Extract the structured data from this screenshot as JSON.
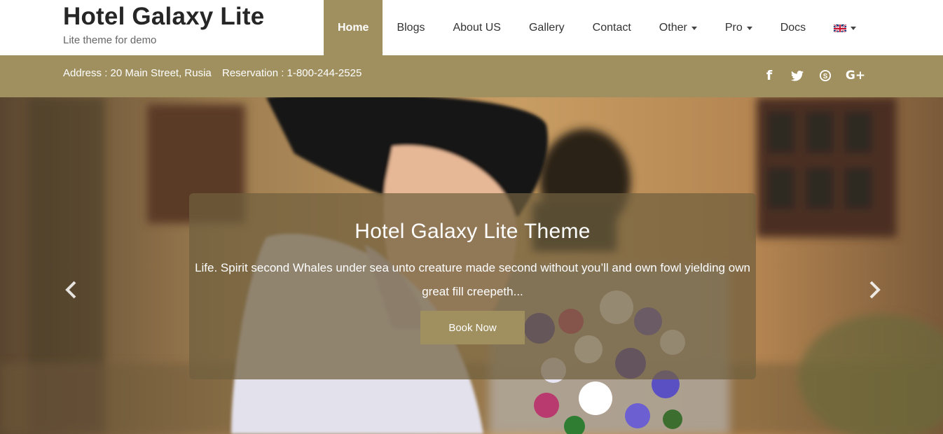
{
  "brand": {
    "title": "Hotel Galaxy Lite",
    "tagline": "Lite theme for demo"
  },
  "nav": {
    "home": "Home",
    "blogs": "Blogs",
    "about": "About US",
    "gallery": "Gallery",
    "contact": "Contact",
    "other": "Other",
    "pro": "Pro",
    "docs": "Docs",
    "language_icon": "uk-flag-icon"
  },
  "info": {
    "address": "Address : 20 Main Street, Rusia",
    "reservation": "Reservation : 1-800-244-2525"
  },
  "social": {
    "facebook": "f",
    "twitter": "twitter-icon",
    "skype": "skype-icon",
    "google_plus": "G+"
  },
  "hero": {
    "title": "Hotel Galaxy Lite Theme",
    "text": "Life. Spirit second Whales under sea unto creature made second without you’ll and own fowl yielding own great fill creepeth...",
    "button": "Book Now"
  },
  "colors": {
    "accent": "#a0905f",
    "header_bg": "#ffffff",
    "caption_bg": "rgba(112,96,62,0.72)"
  }
}
